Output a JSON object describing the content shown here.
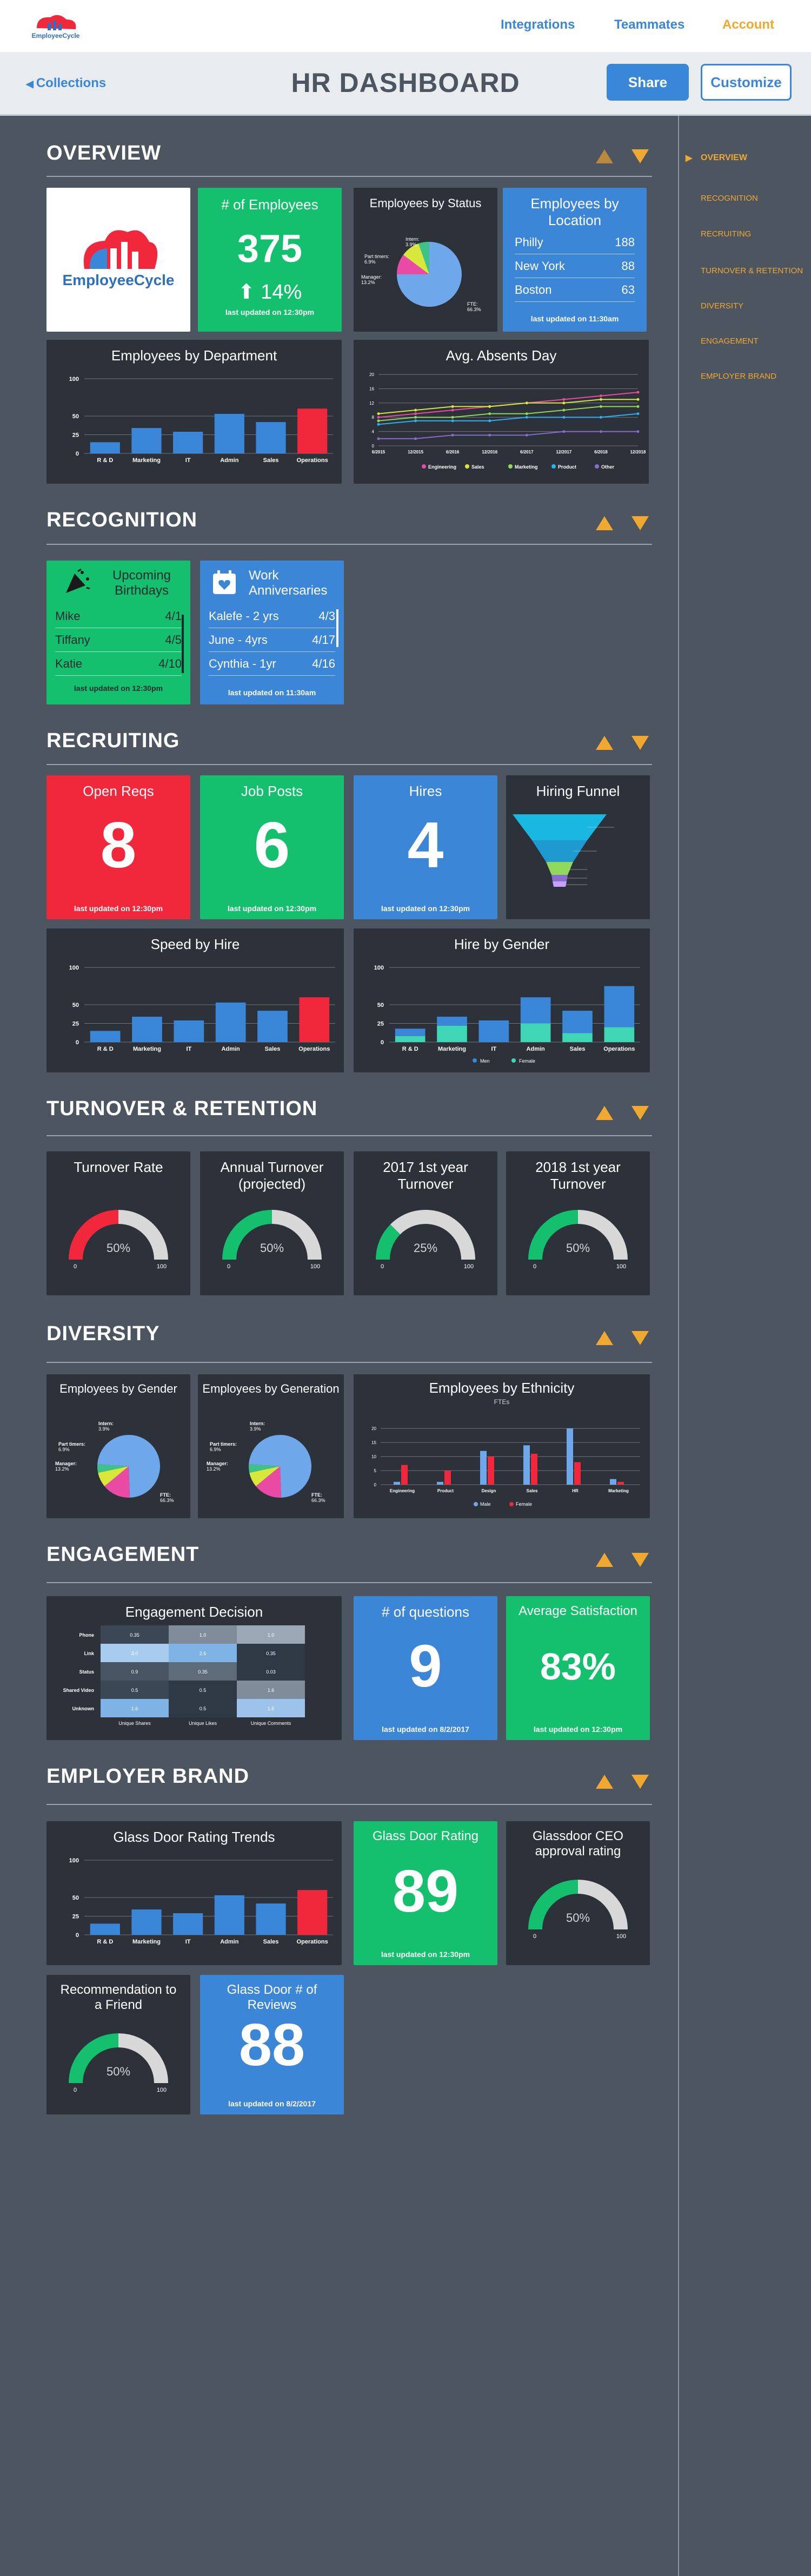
{
  "nav": {
    "integrations": "Integrations",
    "teammates": "Teammates",
    "account": "Account",
    "collections": "Collections",
    "title": "HR DASHBOARD",
    "share": "Share",
    "customize": "Customize",
    "logo_text": "EmployeeCycle"
  },
  "sidebar": [
    "OVERVIEW",
    "RECOGNITION",
    "RECRUITING",
    "TURNOVER & RETENTION",
    "DIVERSITY",
    "ENGAGEMENT",
    "EMPLOYER BRAND"
  ],
  "colors": {
    "green": "#14c06d",
    "blue": "#3b86d6",
    "red": "#f1283c",
    "orange": "#f0a830",
    "dark": "#2d323a"
  },
  "overview": {
    "title": "OVERVIEW",
    "employees": {
      "title": "# of Employees",
      "value": "375",
      "change": "14%",
      "updated": "last updated on 12:30pm"
    },
    "status": {
      "title": "Employees by Status"
    },
    "location": {
      "title": "Employees by Location",
      "rows": [
        {
          "city": "Philly",
          "n": "188"
        },
        {
          "city": "New York",
          "n": "88"
        },
        {
          "city": "Boston",
          "n": "63"
        }
      ],
      "updated": "last updated on 11:30am"
    },
    "dept": {
      "title": "Employees by Department"
    },
    "absent": {
      "title": "Avg. Absents Day"
    }
  },
  "recognition": {
    "title": "RECOGNITION",
    "birthdays": {
      "title": "Upcoming Birthdays",
      "rows": [
        {
          "name": "Mike",
          "date": "4/1"
        },
        {
          "name": "Tiffany",
          "date": "4/5"
        },
        {
          "name": "Katie",
          "date": "4/10"
        }
      ],
      "updated": "last updated on 12:30pm"
    },
    "anniv": {
      "title": "Work Anniversaries",
      "rows": [
        {
          "name": "Kalefe - 2 yrs",
          "date": "4/3"
        },
        {
          "name": "June - 4yrs",
          "date": "4/17"
        },
        {
          "name": "Cynthia - 1yr",
          "date": "4/16"
        }
      ],
      "updated": "last updated on 11:30am"
    }
  },
  "recruiting": {
    "title": "RECRUITING",
    "reqs": {
      "title": "Open Reqs",
      "value": "8",
      "updated": "last updated on 12:30pm"
    },
    "posts": {
      "title": "Job Posts",
      "value": "6",
      "updated": "last updated on 12:30pm"
    },
    "hires": {
      "title": "Hires",
      "value": "4",
      "updated": "last updated on 12:30pm"
    },
    "funnel": {
      "title": "Hiring Funnel"
    },
    "speed": {
      "title": "Speed by Hire"
    },
    "gender": {
      "title": "Hire by Gender"
    }
  },
  "turnover": {
    "title": "TURNOVER & RETENTION",
    "g1": {
      "title": "Turnover Rate",
      "value": "50%"
    },
    "g2": {
      "title": "Annual Turnover (projected)",
      "value": "50%"
    },
    "g3": {
      "title": "2017 1st year Turnover",
      "value": "25%"
    },
    "g4": {
      "title": "2018 1st year Turnover",
      "value": "50%"
    }
  },
  "diversity": {
    "title": "DIVERSITY",
    "gender": {
      "title": "Employees by Gender"
    },
    "generation": {
      "title": "Employees by Generation"
    },
    "ethnicity": {
      "title": "Employees by Ethnicity",
      "sub": "FTEs"
    }
  },
  "engagement": {
    "title": "ENGAGEMENT",
    "decision": {
      "title": "Engagement Decision"
    },
    "questions": {
      "title": "# of questions",
      "value": "9",
      "updated": "last updated on 8/2/2017"
    },
    "satisfaction": {
      "title": "Average Satisfaction",
      "value": "83%",
      "updated": "last updated on 12:30pm"
    }
  },
  "brand": {
    "title": "EMPLOYER BRAND",
    "trends": {
      "title": "Glass Door Rating Trends"
    },
    "rating": {
      "title": "Glass Door Rating",
      "value": "89",
      "updated": "last updated on 12:30pm"
    },
    "ceo": {
      "title": "Glassdoor CEO approval rating",
      "value": "50%"
    },
    "friend": {
      "title": "Recommendation to a Friend",
      "value": "50%"
    },
    "reviews": {
      "title": "Glass Door # of Reviews",
      "value": "88",
      "updated": "last updated on 8/2/2017"
    }
  },
  "chart_data": [
    {
      "type": "bar",
      "categories": [
        "R & D",
        "Marketing",
        "IT",
        "Admin",
        "Sales",
        "Operations"
      ],
      "values": [
        15,
        34,
        29,
        53,
        42,
        60
      ],
      "ylim": [
        0,
        100
      ],
      "yticks": [
        "0",
        "25",
        "50",
        "100"
      ]
    },
    {
      "type": "line",
      "x": [
        "6/2015",
        "12/2015",
        "6/2016",
        "12/2016",
        "6/2017",
        "12/2017",
        "6/2018",
        "12/2018"
      ],
      "series": [
        {
          "name": "Engineering",
          "values": [
            8,
            9,
            10,
            11,
            12,
            13,
            14,
            15
          ]
        },
        {
          "name": "Sales",
          "values": [
            9,
            10,
            11,
            11,
            12,
            12,
            13,
            13
          ]
        },
        {
          "name": "Marketing",
          "values": [
            7,
            8,
            8,
            9,
            9,
            10,
            11,
            11
          ]
        },
        {
          "name": "Product",
          "values": [
            6,
            7,
            7,
            7,
            8,
            8,
            8,
            9
          ]
        },
        {
          "name": "Other",
          "values": [
            2,
            2,
            3,
            3,
            3,
            4,
            4,
            4
          ]
        }
      ],
      "ylim": [
        0,
        20
      ],
      "yticks": [
        "0",
        "4",
        "8",
        "12",
        "16",
        "20"
      ]
    },
    {
      "type": "pie",
      "labels": [
        "FTE: 66.3%",
        "Manager: 13.2%",
        "Part timers: 6.9%",
        "Intern: 3.9%"
      ],
      "values": [
        66.3,
        13.2,
        6.9,
        3.9
      ]
    },
    {
      "type": "bar",
      "series": [
        {
          "name": "Men",
          "values": [
            10,
            12,
            29,
            35,
            30,
            55
          ]
        },
        {
          "name": "Female",
          "values": [
            8,
            22,
            0,
            25,
            12,
            20
          ]
        }
      ],
      "categories": [
        "R & D",
        "Marketing",
        "IT",
        "Admin",
        "Sales",
        "Operations"
      ],
      "ylim": [
        0,
        100
      ]
    },
    {
      "type": "bar",
      "series": [
        {
          "name": "Male",
          "values": [
            1,
            1,
            12,
            14,
            20,
            2
          ]
        },
        {
          "name": "Female",
          "values": [
            7,
            5,
            10,
            11,
            8,
            1
          ]
        }
      ],
      "categories": [
        "Engineering",
        "Product",
        "Design",
        "Sales",
        "HR",
        "Marketing"
      ],
      "ylim": [
        0,
        20
      ]
    },
    {
      "type": "heatmap",
      "rows": [
        "Phone",
        "Link",
        "Status",
        "Shared Video",
        "Unknown"
      ],
      "columns": [
        "Unique Shares",
        "Unique Likes",
        "Unique Comments"
      ],
      "values": [
        [
          "0.35",
          "1.0",
          "1.0"
        ],
        [
          "3.0",
          "2.6",
          "0.35"
        ],
        [
          "0.9",
          "0.35",
          "0.03"
        ],
        [
          "0.5",
          "0.5",
          "1.6"
        ],
        [
          "1.6",
          "0.5",
          "1.5"
        ]
      ]
    }
  ]
}
